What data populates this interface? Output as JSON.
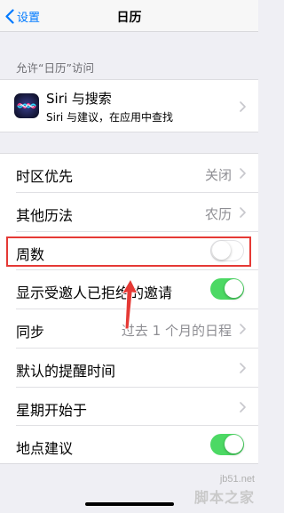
{
  "navbar": {
    "back_label": "设置",
    "title": "日历"
  },
  "access_section": {
    "header": "允许“日历”访问",
    "siri": {
      "title": "Siri 与搜索",
      "subtitle": "Siri 与建议，在应用中查找"
    }
  },
  "settings": {
    "time_zone_override": {
      "label": "时区优先",
      "value": "关闭"
    },
    "alternate_calendars": {
      "label": "其他历法",
      "value": "农历"
    },
    "week_numbers": {
      "label": "周数",
      "enabled": false
    },
    "show_declined": {
      "label": "显示受邀人已拒绝的邀请",
      "enabled": true
    },
    "sync": {
      "label": "同步",
      "value": "过去 1 个月的日程"
    },
    "default_alert": {
      "label": "默认的提醒时间"
    },
    "week_start": {
      "label": "星期开始于"
    },
    "location_suggestions": {
      "label": "地点建议",
      "enabled": true
    }
  },
  "annotation": {
    "box_color": "#e53935",
    "arrow_color": "#e53935"
  },
  "colors": {
    "accent": "#007aff",
    "toggle_on": "#4cd964",
    "value_gray": "#8e8e93"
  },
  "watermark": {
    "site": "jb51.net",
    "name": "脚本之家"
  }
}
